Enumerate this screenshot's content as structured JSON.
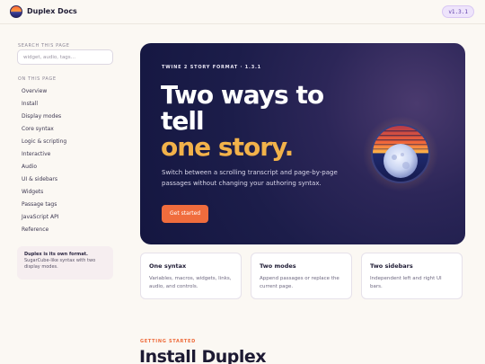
{
  "header": {
    "brand": "Duplex Docs",
    "version": "v1.3.1"
  },
  "sidebar": {
    "search_label": "SEARCH THIS PAGE",
    "search_placeholder": "widget, audio, tags…",
    "nav_label": "ON THIS PAGE",
    "items": [
      {
        "label": "Overview"
      },
      {
        "label": "Install"
      },
      {
        "label": "Display modes"
      },
      {
        "label": "Core syntax"
      },
      {
        "label": "Logic & scripting"
      },
      {
        "label": "Interactive"
      },
      {
        "label": "Audio"
      },
      {
        "label": "UI & sidebars"
      },
      {
        "label": "Widgets"
      },
      {
        "label": "Passage tags"
      },
      {
        "label": "JavaScript API"
      },
      {
        "label": "Reference"
      }
    ],
    "note_title": "Duplex is its own format.",
    "note_body": "SugarCube-like syntax with two display modes."
  },
  "hero": {
    "eyebrow": "TWINE 2 STORY FORMAT · 1.3.1",
    "title_line1": "Two ways to",
    "title_line2": "tell",
    "title_accent": "one story.",
    "subtitle": "Switch between a scrolling transcript and page-by-page passages without changing your authoring syntax.",
    "cta": "Get started"
  },
  "features": [
    {
      "title": "One syntax",
      "desc": "Variables, macros, widgets, links, audio, and controls."
    },
    {
      "title": "Two modes",
      "desc": "Append passages or replace the current page."
    },
    {
      "title": "Two sidebars",
      "desc": "Independent left and right UI bars."
    }
  ],
  "section": {
    "eyebrow": "GETTING STARTED",
    "title": "Install Duplex"
  },
  "colors": {
    "accent": "#f06c3d",
    "highlight": "#f2b24a",
    "hero_bg": "#1c1d4a",
    "page_bg": "#fbf8f3"
  },
  "icons": {
    "logo": "sun-moon-orb-icon",
    "hero_art": "sunset-moon-orb-icon"
  }
}
